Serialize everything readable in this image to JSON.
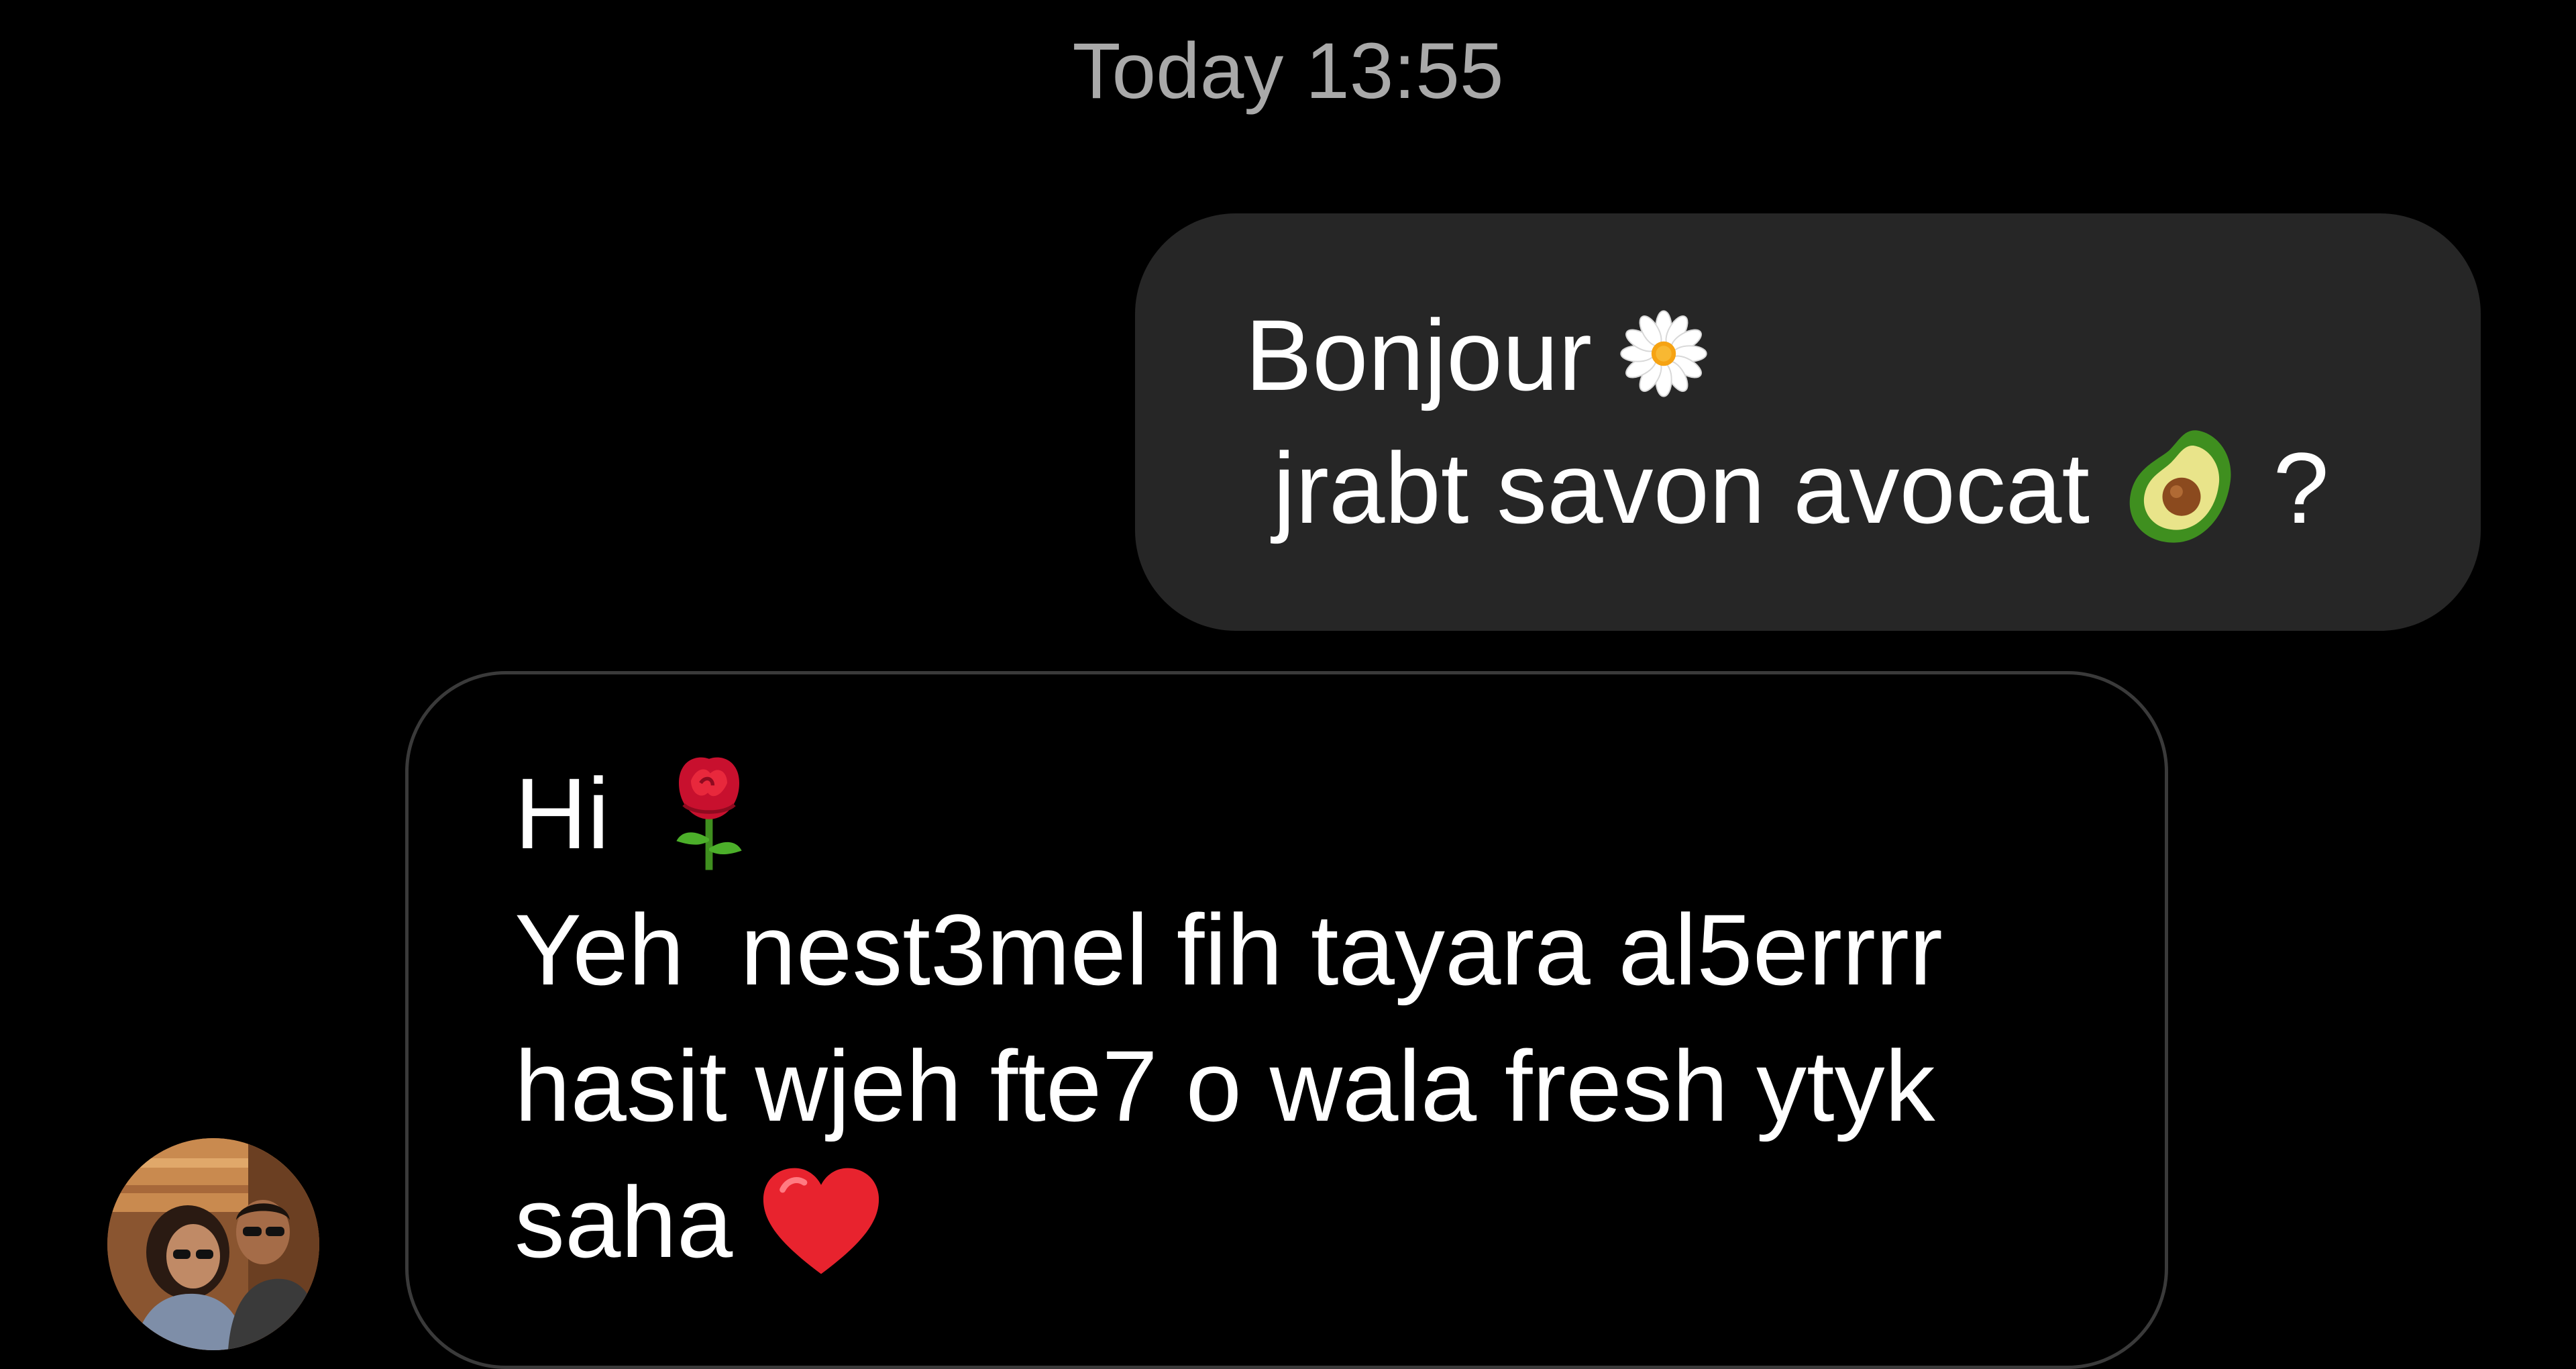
{
  "conversation": {
    "timestamp": "Today 13:55",
    "outgoing": {
      "line1": "Bonjour ",
      "line1_emoji": "daisy-icon",
      "line2": " jrabt savon avocat ",
      "line2_emoji": "avocado-icon",
      "line2_end": " ?"
    },
    "incoming": {
      "line1": "Hi  ",
      "line1_emoji": "rose-icon",
      "line2": "Yeh  nest3mel fih tayara al5errrr",
      "line3": "hasit wjeh fte7 o wala fresh ytyk",
      "line4": "saha ",
      "line4_emoji": "red-heart-icon"
    },
    "sender_avatar": "avatar-photo"
  },
  "colors": {
    "background": "#000000",
    "outgoing_bubble": "#262626",
    "incoming_border": "#3a3a3a",
    "timestamp": "#a9a9a9",
    "text": "#ffffff"
  }
}
